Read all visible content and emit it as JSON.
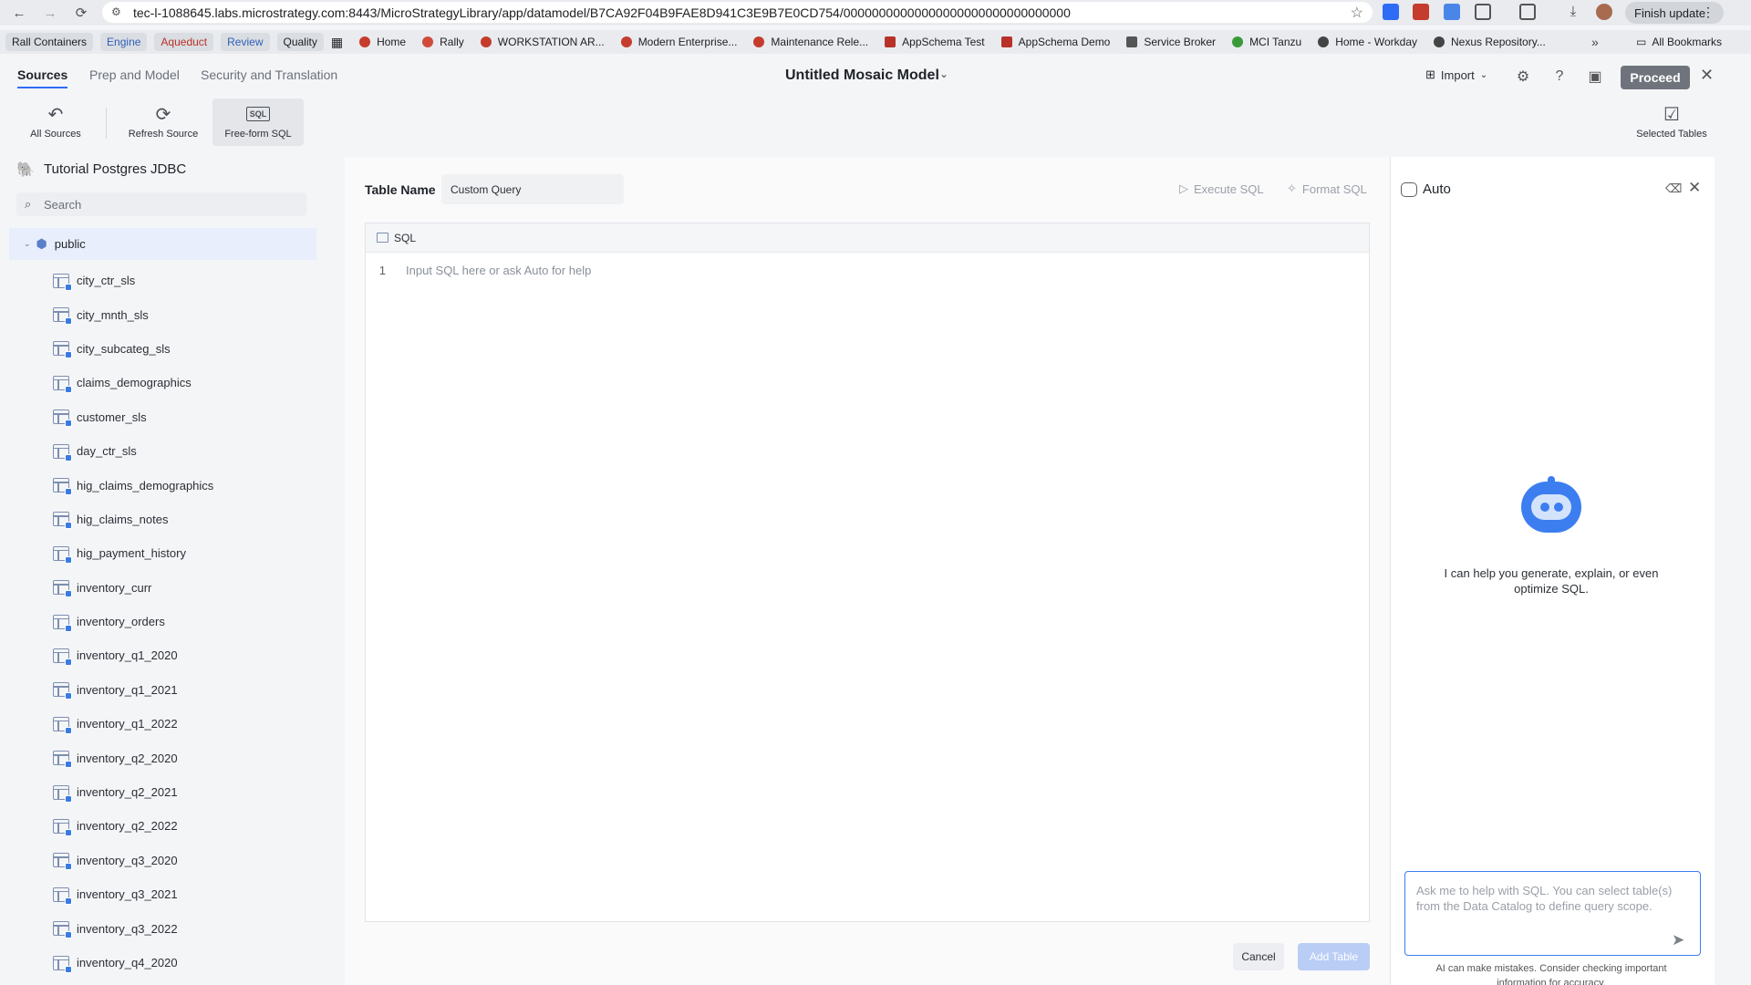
{
  "browser": {
    "url": "tec-l-1088645.labs.microstrategy.com:8443/MicroStrategyLibrary/app/datamodel/B7CA92F04B9FAE8D941C3E9B7E0CD754/00000000000000000000000000000000",
    "finish_update": "Finish update",
    "bookmark_tags": [
      "Rall Containers",
      "Engine",
      "Aqueduct",
      "Review",
      "Quality"
    ],
    "bookmarks": [
      {
        "label": "Home",
        "color": "#c53b2c"
      },
      {
        "label": "Rally",
        "color": "#d04a3b"
      },
      {
        "label": "WORKSTATION AR...",
        "color": "#c53b2c"
      },
      {
        "label": "Modern Enterprise...",
        "color": "#c53b2c"
      },
      {
        "label": "Maintenance Rele...",
        "color": "#c53b2c"
      },
      {
        "label": "AppSchema Test",
        "color": "#b8322a"
      },
      {
        "label": "AppSchema Demo",
        "color": "#b8322a"
      },
      {
        "label": "Service Broker",
        "color": "#555555"
      },
      {
        "label": "MCI Tanzu",
        "color": "#3a9a3a"
      },
      {
        "label": "Home - Workday",
        "color": "#444444"
      },
      {
        "label": "Nexus Repository...",
        "color": "#444444"
      }
    ],
    "all_bookmarks": "All Bookmarks"
  },
  "header": {
    "tabs": [
      "Sources",
      "Prep and Model",
      "Security and Translation"
    ],
    "model_title": "Untitled Mosaic Model",
    "import_label": "Import",
    "proceed_label": "Proceed"
  },
  "toolbar": {
    "all_sources": "All Sources",
    "refresh_source": "Refresh Source",
    "free_form_sql": "Free-form SQL",
    "sql_glyph": "SQL",
    "selected_tables": "Selected Tables"
  },
  "sidebar": {
    "source_name": "Tutorial Postgres JDBC",
    "search_placeholder": "Search",
    "schema": "public",
    "tables": [
      "city_ctr_sls",
      "city_mnth_sls",
      "city_subcateg_sls",
      "claims_demographics",
      "customer_sls",
      "day_ctr_sls",
      "hig_claims_demographics",
      "hig_claims_notes",
      "hig_payment_history",
      "inventory_curr",
      "inventory_orders",
      "inventory_q1_2020",
      "inventory_q1_2021",
      "inventory_q1_2022",
      "inventory_q2_2020",
      "inventory_q2_2021",
      "inventory_q2_2022",
      "inventory_q3_2020",
      "inventory_q3_2021",
      "inventory_q3_2022",
      "inventory_q4_2020"
    ]
  },
  "editor": {
    "table_name_label": "Table Name",
    "table_name_value": "Custom Query",
    "execute_sql": "Execute SQL",
    "format_sql": "Format SQL",
    "sql_header": "SQL",
    "line_number": "1",
    "placeholder": "Input SQL here or ask Auto for help",
    "cancel": "Cancel",
    "add_table": "Add Table"
  },
  "auto": {
    "title": "Auto",
    "help_text": "I can help you generate, explain, or even optimize SQL.",
    "input_placeholder": "Ask me to help with SQL. You can select table(s) from the Data Catalog to define query scope.",
    "disclaimer": "AI can make mistakes. Consider checking important information for accuracy."
  }
}
